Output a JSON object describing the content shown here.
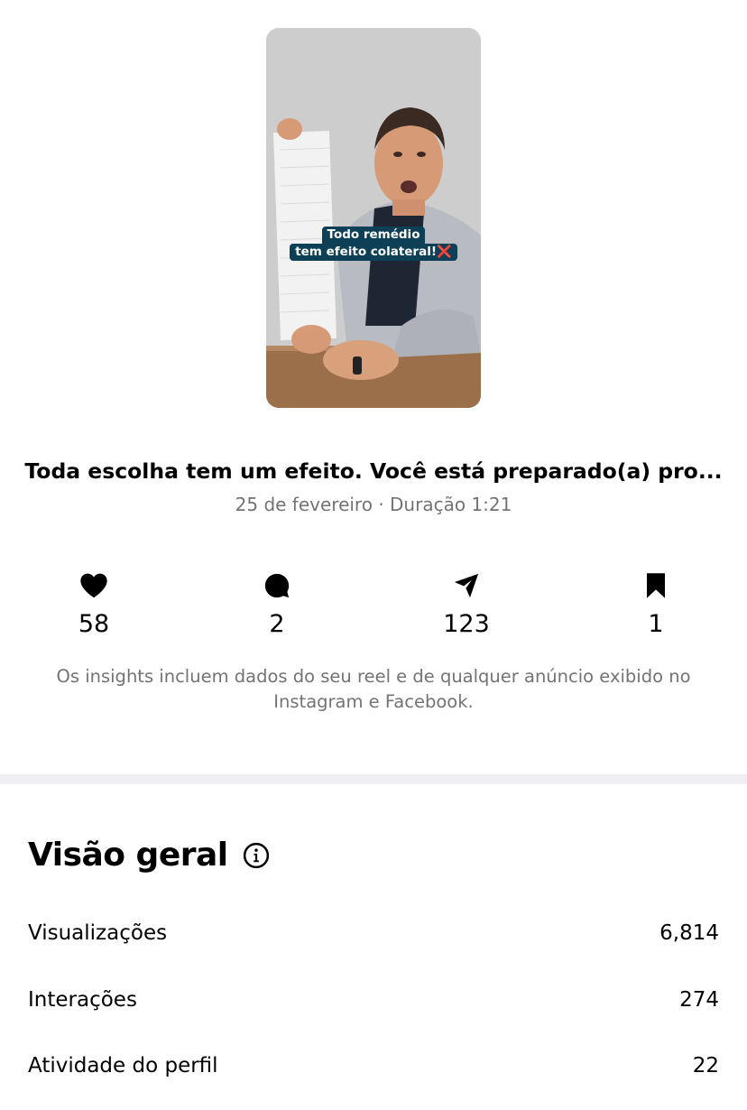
{
  "reel": {
    "overlay_line1": "Todo remédio",
    "overlay_line2": "tem efeito colateral!",
    "overlay_mark": "❌",
    "title": "Toda escolha tem um efeito. Você está preparado(a) pro...",
    "meta": "25 de fevereiro · Duração 1:21"
  },
  "stats": {
    "likes": "58",
    "comments": "2",
    "shares": "123",
    "saves": "1"
  },
  "icons": {
    "likes": "heart-icon",
    "comments": "comment-bubble-icon",
    "shares": "paper-plane-icon",
    "saves": "bookmark-icon",
    "info": "info-circle-icon"
  },
  "disclaimer": "Os insights incluem dados do seu reel e de qualquer anúncio exibido no Instagram e Facebook.",
  "overview": {
    "title": "Visão geral",
    "rows": [
      {
        "label": "Visualizações",
        "value": "6,814"
      },
      {
        "label": "Interações",
        "value": "274"
      },
      {
        "label": "Atividade do perfil",
        "value": "22"
      }
    ]
  },
  "colors": {
    "secondary_text": "#737373",
    "divider": "#efeff3",
    "caption_background": "#0d3f57",
    "caption_mark": "#e8232e"
  }
}
